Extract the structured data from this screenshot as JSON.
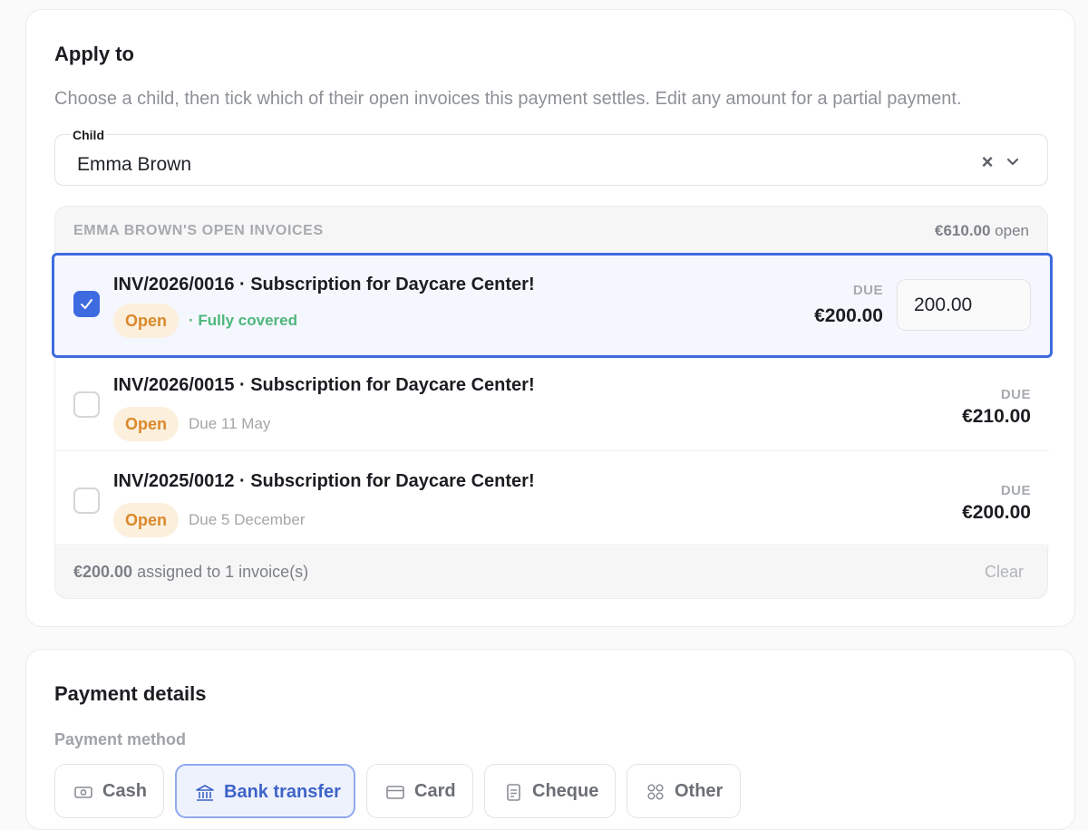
{
  "apply": {
    "title": "Apply to",
    "helper": "Choose a child, then tick which of their open invoices this payment settles. Edit any amount for a partial payment.",
    "child_label": "Child",
    "child_value": "Emma Brown",
    "invoices_header": "EMMA BROWN'S OPEN INVOICES",
    "invoices_total": "€610.00",
    "invoices_total_suffix": " open",
    "invoices": [
      {
        "title": "INV/2026/0016 · Subscription for Daycare Center!",
        "status": "Open",
        "note": "· Fully covered",
        "due_label": "DUE",
        "due_amount": "€200.00",
        "applied_amount": "200.00",
        "checked": true
      },
      {
        "title": "INV/2026/0015 · Subscription for Daycare Center!",
        "status": "Open",
        "note": "Due 11 May",
        "due_label": "DUE",
        "due_amount": "€210.00",
        "checked": false
      },
      {
        "title": "INV/2025/0012 · Subscription for Daycare Center!",
        "status": "Open",
        "note": "Due 5 December",
        "due_label": "DUE",
        "due_amount": "€200.00",
        "checked": false
      }
    ],
    "footer_amount": "€200.00",
    "footer_text": " assigned to 1 invoice(s)",
    "clear_label": "Clear"
  },
  "payment": {
    "title": "Payment details",
    "method_label": "Payment method",
    "methods": [
      {
        "label": "Cash",
        "icon": "cash-icon",
        "active": false
      },
      {
        "label": "Bank transfer",
        "icon": "bank-icon",
        "active": true
      },
      {
        "label": "Card",
        "icon": "card-icon",
        "active": false
      },
      {
        "label": "Cheque",
        "icon": "cheque-icon",
        "active": false
      },
      {
        "label": "Other",
        "icon": "grid-icon",
        "active": false
      }
    ]
  },
  "colors": {
    "accent": "#3e6be0",
    "badge_bg": "#fcefdc",
    "badge_text": "#d9892c",
    "covered_text": "#4fb77c"
  }
}
